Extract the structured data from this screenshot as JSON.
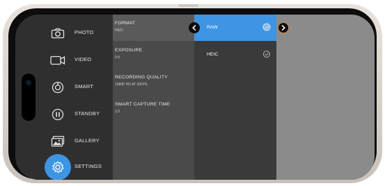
{
  "nav": {
    "items": [
      {
        "label": "PHOTO",
        "icon": "camera-icon",
        "active": false
      },
      {
        "label": "VIDEO",
        "icon": "video-camera-icon",
        "active": false
      },
      {
        "label": "SMART",
        "icon": "smart-capture-icon",
        "active": false
      },
      {
        "label": "STANDBY",
        "icon": "pause-icon",
        "active": false
      },
      {
        "label": "GALLERY",
        "icon": "gallery-icon",
        "active": false
      },
      {
        "label": "SETTINGS",
        "icon": "settings-gear-icon",
        "active": true
      }
    ]
  },
  "settings": {
    "items": [
      {
        "title": "FORMAT",
        "value": "HEIC"
      },
      {
        "title": "EXPOSURE",
        "value": "0.0"
      },
      {
        "title": "RECORDING QUALITY",
        "value": "1080P HD AT 30FPS"
      },
      {
        "title": "SMART CAPTURE TIME",
        "value": "1.0"
      }
    ]
  },
  "options": {
    "items": [
      {
        "label": "RAW",
        "selected": true
      },
      {
        "label": "HEIC",
        "selected": false
      }
    ]
  },
  "colors": {
    "accent": "#3d95e3",
    "nav_bg": "#2f2f2f",
    "settings_bg": "#4a4a4a",
    "options_bg": "#3a3a3a",
    "preview_bg": "#8b8b8b",
    "arrow_ring": "#d98a3a"
  }
}
